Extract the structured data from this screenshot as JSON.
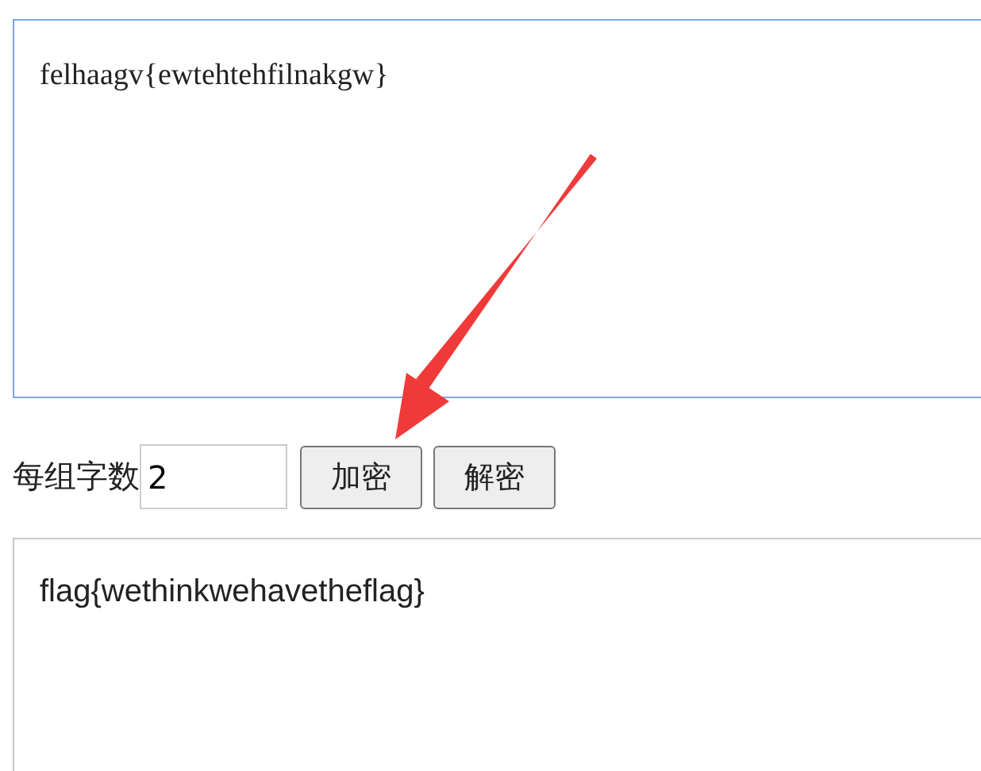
{
  "cipher_text": {
    "value": "felhaagv{ewtehtehfilnakgw}",
    "focused": true
  },
  "group_size": {
    "label": "每组字数",
    "value": "2"
  },
  "buttons": [
    {
      "label": "加密"
    },
    {
      "label": "解密"
    }
  ],
  "plain_text": {
    "value": "flag{wethinkwehavetheflag}"
  }
}
